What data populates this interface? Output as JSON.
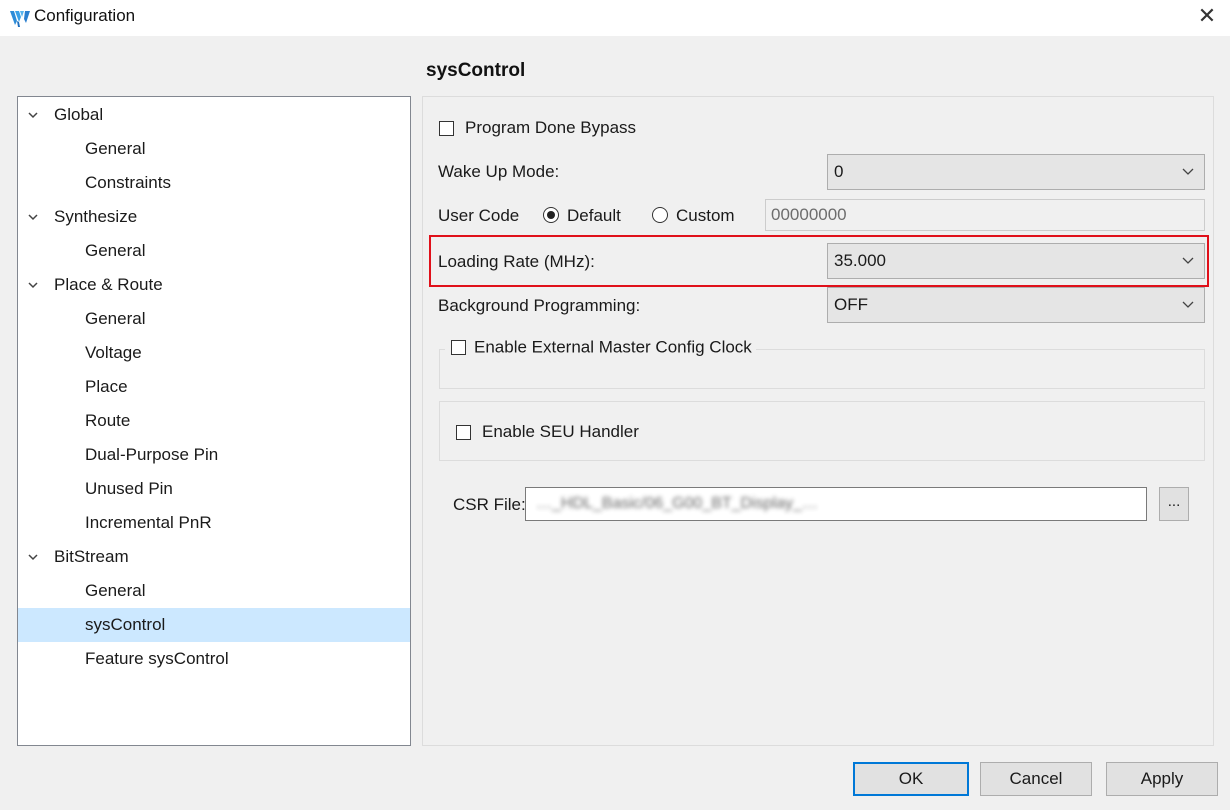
{
  "window": {
    "title": "Configuration",
    "close_glyph": "✕"
  },
  "page_title": "sysControl",
  "tree": [
    {
      "label": "Global",
      "level": 0,
      "expanded": true
    },
    {
      "label": "General",
      "level": 1
    },
    {
      "label": "Constraints",
      "level": 1
    },
    {
      "label": "Synthesize",
      "level": 0,
      "expanded": true
    },
    {
      "label": "General",
      "level": 1
    },
    {
      "label": "Place & Route",
      "level": 0,
      "expanded": true
    },
    {
      "label": "General",
      "level": 1
    },
    {
      "label": "Voltage",
      "level": 1
    },
    {
      "label": "Place",
      "level": 1
    },
    {
      "label": "Route",
      "level": 1
    },
    {
      "label": "Dual-Purpose Pin",
      "level": 1
    },
    {
      "label": "Unused Pin",
      "level": 1
    },
    {
      "label": "Incremental PnR",
      "level": 1
    },
    {
      "label": "BitStream",
      "level": 0,
      "expanded": true
    },
    {
      "label": "General",
      "level": 1
    },
    {
      "label": "sysControl",
      "level": 1,
      "selected": true
    },
    {
      "label": "Feature sysControl",
      "level": 1
    }
  ],
  "form": {
    "program_done_bypass": {
      "label": "Program Done Bypass",
      "checked": false
    },
    "wake_up_mode": {
      "label": "Wake Up Mode:",
      "value": "0"
    },
    "user_code": {
      "label": "User Code",
      "default_label": "Default",
      "custom_label": "Custom",
      "selected": "Default",
      "value": "00000000"
    },
    "loading_rate": {
      "label": "Loading Rate (MHz):",
      "value": "35.000"
    },
    "background_programming": {
      "label": "Background Programming:",
      "value": "OFF"
    },
    "external_master_clock": {
      "label": "Enable External Master Config Clock",
      "checked": false
    },
    "seu_handler": {
      "label": "Enable SEU Handler",
      "checked": false
    },
    "csr_file": {
      "label": "CSR File:",
      "value": "…_HDL_Basic/06_G00_BT_Display_…",
      "browse_label": "..."
    }
  },
  "buttons": {
    "ok": "OK",
    "cancel": "Cancel",
    "apply": "Apply"
  },
  "colors": {
    "selection": "#cce8ff",
    "highlight": "#e0101a",
    "default_button_border": "#0078d7"
  }
}
